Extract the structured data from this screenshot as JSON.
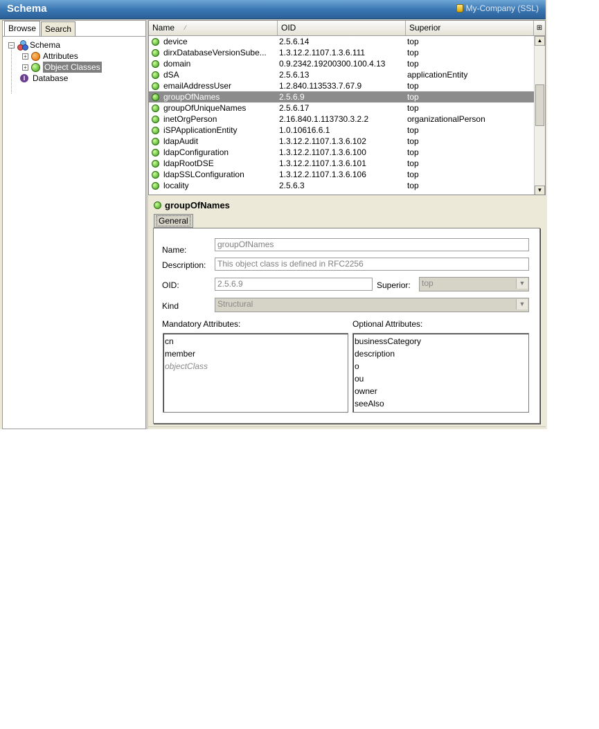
{
  "app": {
    "title": "Schema",
    "server": "My-Company (SSL)"
  },
  "left_tabs": [
    {
      "label": "Browse"
    },
    {
      "label": "Search"
    }
  ],
  "tree": {
    "root": "Schema",
    "items": [
      {
        "label": "Attributes"
      },
      {
        "label": "Object Classes"
      },
      {
        "label": "Database"
      }
    ]
  },
  "table": {
    "columns": [
      "Name",
      "OID",
      "Superior"
    ],
    "rows": [
      {
        "name": "device",
        "oid": "2.5.6.14",
        "superior": "top"
      },
      {
        "name": "dirxDatabaseVersionSube...",
        "oid": "1.3.12.2.1107.1.3.6.111",
        "superior": "top"
      },
      {
        "name": "domain",
        "oid": "0.9.2342.19200300.100.4.13",
        "superior": "top"
      },
      {
        "name": "dSA",
        "oid": "2.5.6.13",
        "superior": "applicationEntity"
      },
      {
        "name": "emailAddressUser",
        "oid": "1.2.840.113533.7.67.9",
        "superior": "top"
      },
      {
        "name": "groupOfNames",
        "oid": "2.5.6.9",
        "superior": "top"
      },
      {
        "name": "groupOfUniqueNames",
        "oid": "2.5.6.17",
        "superior": "top"
      },
      {
        "name": "inetOrgPerson",
        "oid": "2.16.840.1.113730.3.2.2",
        "superior": "organizationalPerson"
      },
      {
        "name": "iSPApplicationEntity",
        "oid": "1.0.10616.6.1",
        "superior": "top"
      },
      {
        "name": "ldapAudit",
        "oid": "1.3.12.2.1107.1.3.6.102",
        "superior": "top"
      },
      {
        "name": "ldapConfiguration",
        "oid": "1.3.12.2.1107.1.3.6.100",
        "superior": "top"
      },
      {
        "name": "ldapRootDSE",
        "oid": "1.3.12.2.1107.1.3.6.101",
        "superior": "top"
      },
      {
        "name": "ldapSSLConfiguration",
        "oid": "1.3.12.2.1107.1.3.6.106",
        "superior": "top"
      },
      {
        "name": "locality",
        "oid": "2.5.6.3",
        "superior": "top"
      }
    ],
    "selected_row": 5
  },
  "detail": {
    "title": "groupOfNames",
    "tab": "General",
    "labels": {
      "name": "Name:",
      "description": "Description:",
      "oid": "OID:",
      "superior": "Superior:",
      "kind": "Kind",
      "mandatory": "Mandatory Attributes:",
      "optional": "Optional Attributes:"
    },
    "values": {
      "name": "groupOfNames",
      "description": "This object class is defined in RFC2256",
      "oid": "2.5.6.9",
      "superior": "top",
      "kind": "Structural"
    },
    "mandatory": [
      "cn",
      "member",
      "objectClass"
    ],
    "optional": [
      "businessCategory",
      "description",
      "o",
      "ou",
      "owner",
      "seeAlso"
    ]
  },
  "icons": {
    "expand": "expand-icon",
    "db": "database-icon",
    "object_class": "object-class-icon",
    "attribute": "attribute-icon"
  }
}
